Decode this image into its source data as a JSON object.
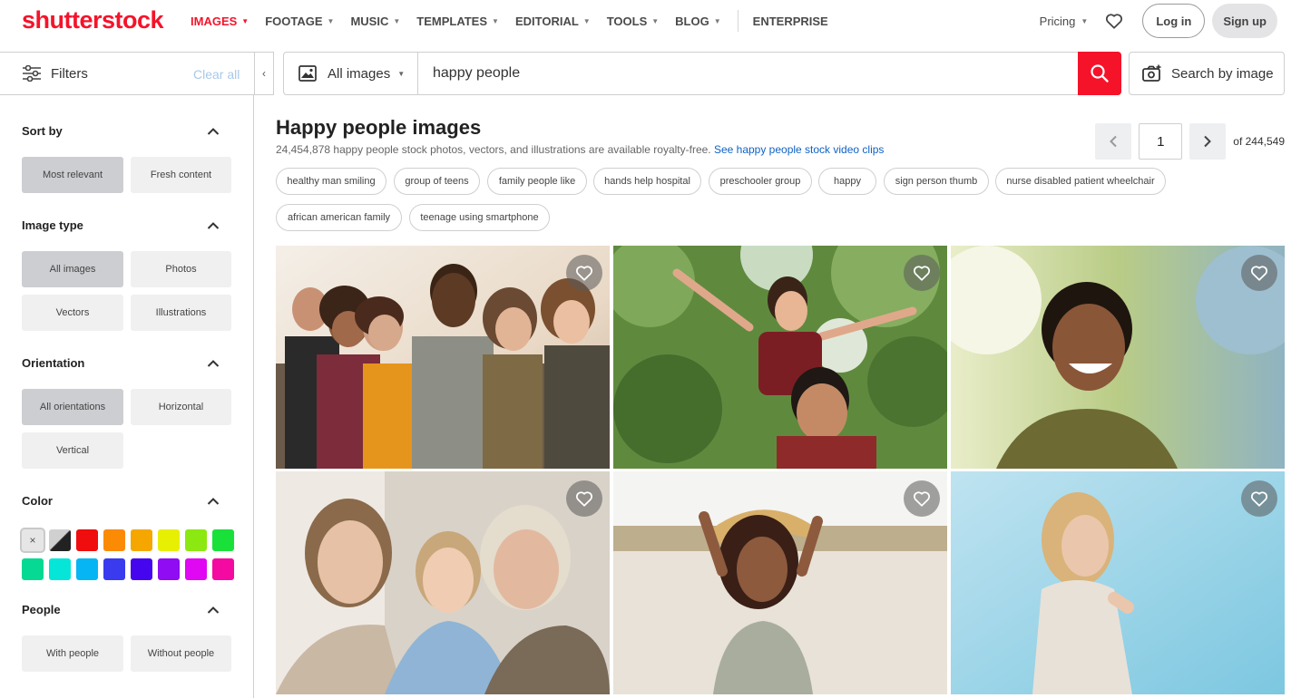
{
  "brand": {
    "logo_text": "shutterstock",
    "accent": "#f5132a"
  },
  "nav": {
    "items": [
      {
        "label": "IMAGES",
        "active": true,
        "dropdown": true
      },
      {
        "label": "FOOTAGE",
        "dropdown": true
      },
      {
        "label": "MUSIC",
        "dropdown": true
      },
      {
        "label": "TEMPLATES",
        "dropdown": true
      },
      {
        "label": "EDITORIAL",
        "dropdown": true
      },
      {
        "label": "TOOLS",
        "dropdown": true
      },
      {
        "label": "BLOG",
        "dropdown": true
      },
      {
        "label": "ENTERPRISE",
        "dropdown": false
      }
    ],
    "pricing": "Pricing",
    "login": "Log in",
    "signup": "Sign up"
  },
  "filters": {
    "label": "Filters",
    "clear_all": "Clear all"
  },
  "search": {
    "type_label": "All images",
    "query": "happy people",
    "by_image": "Search by image"
  },
  "sidebar": {
    "sort": {
      "title": "Sort by",
      "options": [
        "Most relevant",
        "Fresh content"
      ]
    },
    "image_type": {
      "title": "Image type",
      "options": [
        "All images",
        "Photos",
        "Vectors",
        "Illustrations"
      ]
    },
    "orientation": {
      "title": "Orientation",
      "options": [
        "All orientations",
        "Horizontal",
        "Vertical"
      ]
    },
    "color": {
      "title": "Color",
      "clear_symbol": "×",
      "swatches": [
        "#e6e6e6",
        "#222222",
        "#ef0d0d",
        "#fb8a05",
        "#f5a700",
        "#e7f002",
        "#8be810",
        "#1ae03a",
        "#06d993",
        "#06e6d8",
        "#06b6f4",
        "#3a3bef",
        "#4605ef",
        "#8f0cf3",
        "#e007f3",
        "#f40aa1"
      ]
    },
    "people": {
      "title": "People",
      "options": [
        "With people",
        "Without people"
      ]
    }
  },
  "results": {
    "title": "Happy people images",
    "subtitle": "24,454,878 happy people stock photos, vectors, and illustrations are available royalty-free.",
    "video_link": "See happy people stock video clips",
    "page": "1",
    "of_pages": "of 244,549",
    "chips": [
      "healthy man smiling",
      "group of teens",
      "family people like",
      "hands help hospital",
      "preschooler group",
      "happy",
      "sign person thumb",
      "nurse disabled patient wheelchair",
      "african american family",
      "teenage using smartphone"
    ]
  }
}
